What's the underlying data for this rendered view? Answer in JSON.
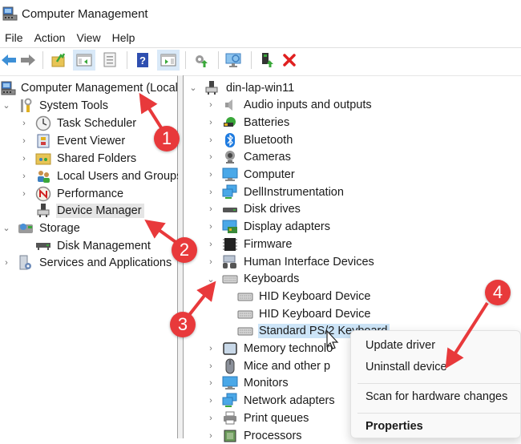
{
  "window": {
    "title": "Computer Management"
  },
  "menu": [
    "File",
    "Action",
    "View",
    "Help"
  ],
  "toolbar": {
    "buttons": [
      {
        "name": "back-icon"
      },
      {
        "name": "forward-icon"
      },
      {
        "name": "up-folder-icon"
      },
      {
        "name": "show-hide-console-tree-icon"
      },
      {
        "name": "properties-icon"
      },
      {
        "name": "help-icon"
      },
      {
        "name": "show-hide-action-pane-icon"
      },
      {
        "name": "update-driver-icon"
      },
      {
        "name": "scan-hardware-icon"
      },
      {
        "name": "enable-device-icon"
      },
      {
        "name": "uninstall-device-icon"
      }
    ]
  },
  "left_tree": [
    {
      "label": "Computer Management (Local)",
      "level": 0,
      "expander": "none"
    },
    {
      "label": "System Tools",
      "level": 1,
      "expander": "expanded"
    },
    {
      "label": "Task Scheduler",
      "level": 2,
      "expander": "collapsed"
    },
    {
      "label": "Event Viewer",
      "level": 2,
      "expander": "collapsed"
    },
    {
      "label": "Shared Folders",
      "level": 2,
      "expander": "collapsed"
    },
    {
      "label": "Local Users and Groups",
      "level": 2,
      "expander": "collapsed"
    },
    {
      "label": "Performance",
      "level": 2,
      "expander": "collapsed"
    },
    {
      "label": "Device Manager",
      "level": 2,
      "expander": "none",
      "selected": true
    },
    {
      "label": "Storage",
      "level": 1,
      "expander": "expanded"
    },
    {
      "label": "Disk Management",
      "level": 2,
      "expander": "none"
    },
    {
      "label": "Services and Applications",
      "level": 1,
      "expander": "collapsed"
    }
  ],
  "right_tree": [
    {
      "label": "din-lap-win11",
      "level": 0,
      "expander": "expanded"
    },
    {
      "label": "Audio inputs and outputs",
      "level": 1,
      "expander": "collapsed"
    },
    {
      "label": "Batteries",
      "level": 1,
      "expander": "collapsed"
    },
    {
      "label": "Bluetooth",
      "level": 1,
      "expander": "collapsed"
    },
    {
      "label": "Cameras",
      "level": 1,
      "expander": "collapsed"
    },
    {
      "label": "Computer",
      "level": 1,
      "expander": "collapsed"
    },
    {
      "label": "DellInstrumentation",
      "level": 1,
      "expander": "collapsed"
    },
    {
      "label": "Disk drives",
      "level": 1,
      "expander": "collapsed"
    },
    {
      "label": "Display adapters",
      "level": 1,
      "expander": "collapsed"
    },
    {
      "label": "Firmware",
      "level": 1,
      "expander": "collapsed"
    },
    {
      "label": "Human Interface Devices",
      "level": 1,
      "expander": "collapsed"
    },
    {
      "label": "Keyboards",
      "level": 1,
      "expander": "expanded"
    },
    {
      "label": "HID Keyboard Device",
      "level": 2,
      "expander": "none"
    },
    {
      "label": "HID Keyboard Device",
      "level": 2,
      "expander": "none"
    },
    {
      "label": "Standard PS/2 Keyboard",
      "level": 2,
      "expander": "none",
      "highlighted": true
    },
    {
      "label": "Memory technolo",
      "level": 1,
      "expander": "collapsed"
    },
    {
      "label": "Mice and other p",
      "level": 1,
      "expander": "collapsed"
    },
    {
      "label": "Monitors",
      "level": 1,
      "expander": "collapsed"
    },
    {
      "label": "Network adapters",
      "level": 1,
      "expander": "collapsed"
    },
    {
      "label": "Print queues",
      "level": 1,
      "expander": "collapsed"
    },
    {
      "label": "Processors",
      "level": 1,
      "expander": "collapsed"
    }
  ],
  "context_menu": {
    "update_driver": "Update driver",
    "uninstall_device": "Uninstall device",
    "scan_hardware": "Scan for hardware changes",
    "properties": "Properties"
  },
  "annotations": {
    "badges": [
      "1",
      "2",
      "3",
      "4"
    ],
    "color": "#e8393b"
  }
}
